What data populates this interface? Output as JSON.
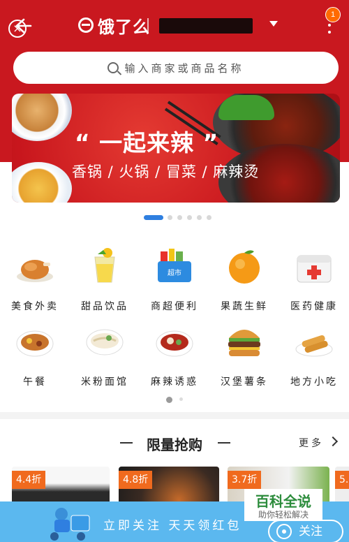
{
  "header": {
    "logo_text": "饿了么",
    "notification_count": "1"
  },
  "search": {
    "placeholder": "输入商家或商品名称"
  },
  "banner": {
    "title": "“ 一起来辣 ”",
    "subtitle": "香锅 / 火锅 / 冒菜 / 麻辣烫",
    "dots_total": 6,
    "active_dot": 0
  },
  "categories": [
    {
      "label": "美食外卖",
      "icon": "roast-chicken-icon"
    },
    {
      "label": "甜品饮品",
      "icon": "drink-cup-icon"
    },
    {
      "label": "商超便利",
      "icon": "supermarket-basket-icon"
    },
    {
      "label": "果蔬生鲜",
      "icon": "orange-fruit-icon"
    },
    {
      "label": "医药健康",
      "icon": "medicine-box-icon"
    },
    {
      "label": "午餐",
      "icon": "lunch-bowl-icon"
    },
    {
      "label": "米粉面馆",
      "icon": "noodle-bowl-icon"
    },
    {
      "label": "麻辣诱惑",
      "icon": "spicy-pot-icon"
    },
    {
      "label": "汉堡薯条",
      "icon": "burger-icon"
    },
    {
      "label": "地方小吃",
      "icon": "spring-roll-icon"
    }
  ],
  "flash_sale": {
    "title": "限量抢购",
    "more_label": "更多",
    "deals": [
      {
        "discount": "4.4折"
      },
      {
        "discount": "4.8折"
      },
      {
        "discount": "3.7折"
      },
      {
        "discount": "5."
      }
    ]
  },
  "follow_bar": {
    "text": "立即关注 天天领红包",
    "button_label": "关注"
  },
  "watermark": {
    "title": "百科全说",
    "subtitle": "助你轻松解决"
  },
  "colors": {
    "brand_red": "#c9181f",
    "accent_blue": "#2f7fe0",
    "follow_bar_blue": "#5bb8ef",
    "discount_orange": "#f06a1e"
  }
}
